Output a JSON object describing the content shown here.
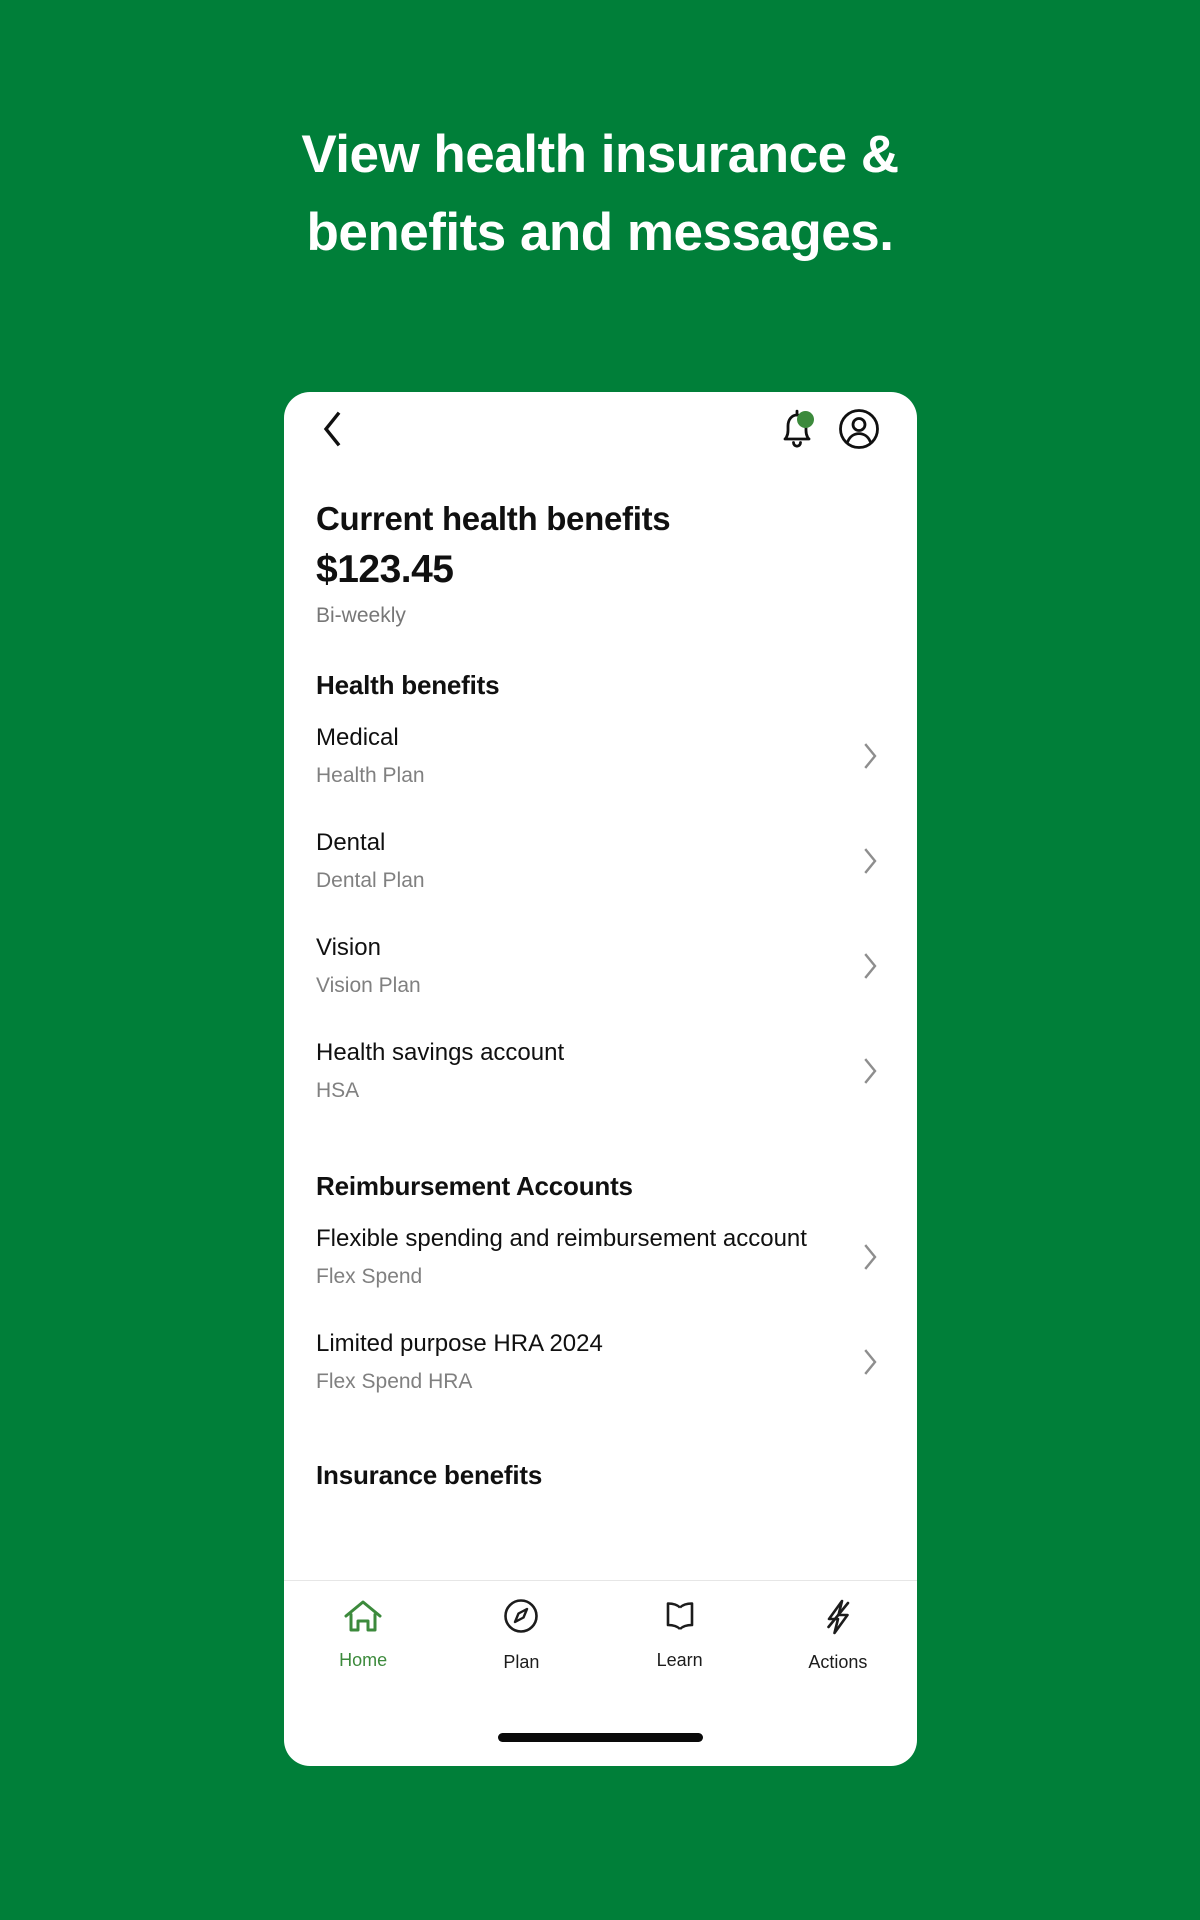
{
  "promo": {
    "headline_line1": "View health insurance &",
    "headline_line2": "benefits and messages.",
    "background_color": "#007F39",
    "text_color": "#FFFFFF"
  },
  "app": {
    "topbar": {
      "back_icon": "chevron-left-icon",
      "notifications_icon": "bell-icon",
      "notifications_badge": true,
      "account_icon": "account-circle-icon"
    },
    "header": {
      "title": "Current health benefits",
      "amount": "$123.45",
      "cadence": "Bi-weekly"
    },
    "sections": [
      {
        "title": "Health benefits",
        "rows": [
          {
            "title": "Medical",
            "subtitle": "Health Plan",
            "chevron": "chevron-right-icon"
          },
          {
            "title": "Dental",
            "subtitle": "Dental Plan",
            "chevron": "chevron-right-icon"
          },
          {
            "title": "Vision",
            "subtitle": "Vision Plan",
            "chevron": "chevron-right-icon"
          },
          {
            "title": "Health savings account",
            "subtitle": "HSA",
            "chevron": "chevron-right-icon"
          }
        ]
      },
      {
        "title": "Reimbursement Accounts",
        "rows": [
          {
            "title": "Flexible spending and reimbursement account",
            "subtitle": "Flex Spend",
            "chevron": "chevron-right-icon"
          },
          {
            "title": "Limited purpose HRA 2024",
            "subtitle": "Flex Spend HRA",
            "chevron": "chevron-right-icon"
          }
        ]
      },
      {
        "title": "Insurance benefits",
        "rows": []
      }
    ],
    "bottom_nav": {
      "active_color": "#3C8A3C",
      "items": [
        {
          "label": "Home",
          "icon": "home-icon",
          "active": true
        },
        {
          "label": "Plan",
          "icon": "compass-icon",
          "active": false
        },
        {
          "label": "Learn",
          "icon": "book-icon",
          "active": false
        },
        {
          "label": "Actions",
          "icon": "lightning-bolt-icon",
          "active": false
        }
      ]
    }
  }
}
